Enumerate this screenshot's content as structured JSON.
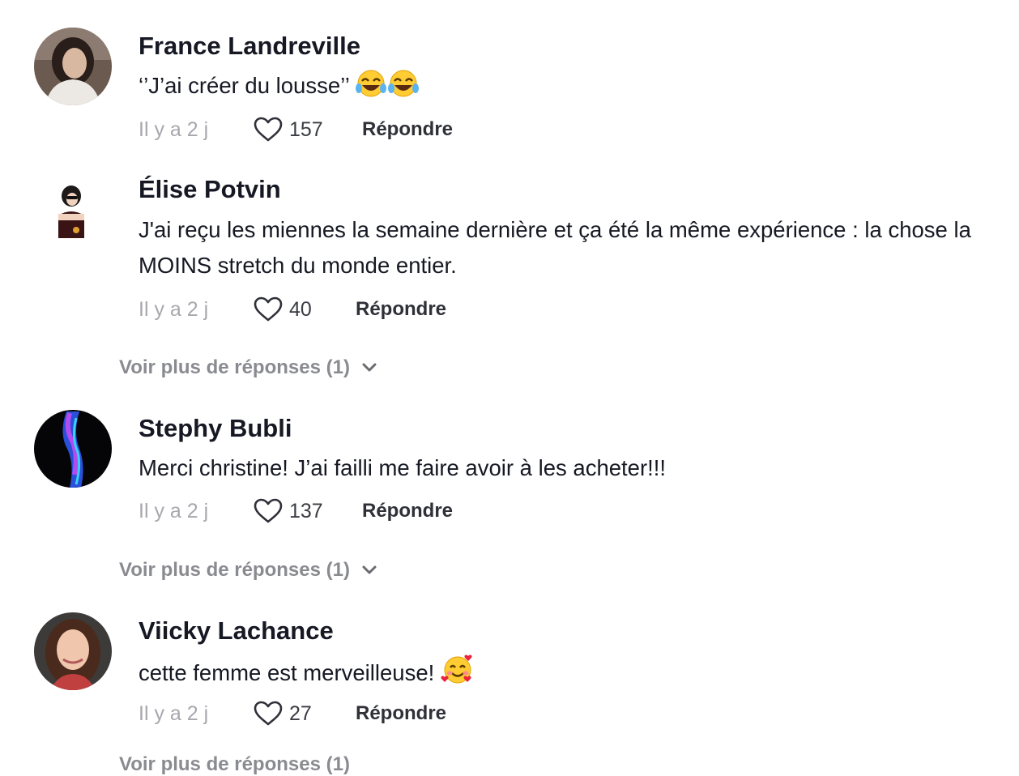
{
  "comments": [
    {
      "username": "France Landreville",
      "text": "‘’J’ai créer du lousse’’",
      "emojis": [
        "face-with-tears-of-joy",
        "face-with-tears-of-joy"
      ],
      "time": "Il y a 2 j",
      "likes": "157",
      "reply_label": "Répondre"
    },
    {
      "username": "Élise Potvin",
      "text": "J'ai reçu les miennes la semaine dernière et ça été la même expérience : la chose la MOINS stretch du monde entier.",
      "time": "Il y a 2 j",
      "likes": "40",
      "reply_label": "Répondre",
      "more_replies": "Voir plus de réponses (1)"
    },
    {
      "username": "Stephy Bubli",
      "text": "Merci christine! J’ai failli me faire avoir à les acheter!!!",
      "time": "Il y a 2 j",
      "likes": "137",
      "reply_label": "Répondre",
      "more_replies": "Voir plus de réponses (1)"
    },
    {
      "username": "Viicky Lachance",
      "text": "cette femme est merveilleuse!",
      "emojis": [
        "smiling-face-with-hearts"
      ],
      "time": "Il y a 2 j",
      "likes": "27",
      "reply_label": "Répondre"
    }
  ],
  "partial_more_replies": "Voir plus de réponses (1)",
  "colors": {
    "username": "#161823",
    "muted": "#a7a8ad",
    "more_replies": "#8a8b91"
  }
}
